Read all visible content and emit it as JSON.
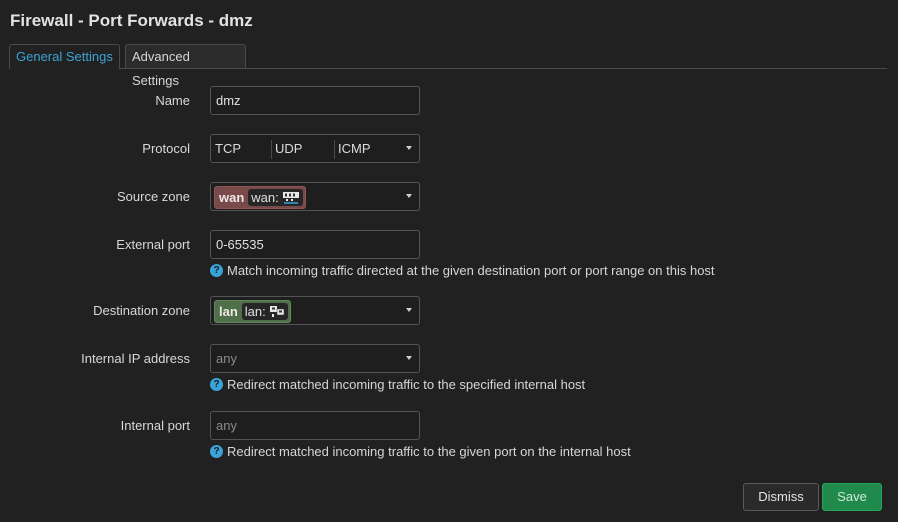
{
  "page": {
    "title": "Firewall - Port Forwards - dmz"
  },
  "tabs": [
    {
      "label": "General Settings",
      "active": true
    },
    {
      "label": "Advanced Settings",
      "active": false
    }
  ],
  "form": {
    "name": {
      "label": "Name",
      "value": "dmz"
    },
    "protocol": {
      "label": "Protocol",
      "options": [
        "TCP",
        "UDP",
        "ICMP"
      ]
    },
    "source_zone": {
      "label": "Source zone",
      "zone": "wan",
      "device": "wan:",
      "color": "#7a4a4a"
    },
    "external_port": {
      "label": "External port",
      "value": "0-65535",
      "hint": "Match incoming traffic directed at the given destination port or port range on this host"
    },
    "destination_zone": {
      "label": "Destination zone",
      "zone": "lan",
      "device": "lan:",
      "color": "#4f6f48"
    },
    "internal_ip": {
      "label": "Internal IP address",
      "placeholder": "any",
      "hint": "Redirect matched incoming traffic to the specified internal host"
    },
    "internal_port": {
      "label": "Internal port",
      "placeholder": "any",
      "hint": "Redirect matched incoming traffic to the given port on the internal host"
    }
  },
  "actions": {
    "dismiss": "Dismiss",
    "save": "Save"
  },
  "icons": {
    "help": "help-icon",
    "device": "network-device-icon",
    "caret": "chevron-down-icon"
  },
  "colors": {
    "accent": "#3aa3d8",
    "save": "#1f8a4c"
  }
}
